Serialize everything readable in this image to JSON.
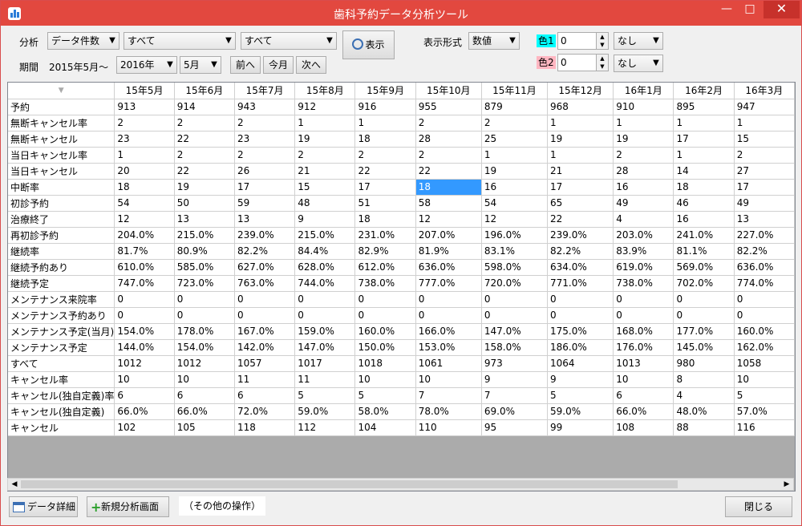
{
  "window": {
    "title": "歯科予約データ分析ツール"
  },
  "toolbar": {
    "analysis_label": "分析",
    "analysis_type": "データ件数",
    "filter1": "すべて",
    "filter2": "すべて",
    "show_button": "表示",
    "period_label": "期間",
    "period_start": "2015年5月～",
    "year": "2016年",
    "month": "5月",
    "prev_button": "前へ",
    "this_month_button": "今月",
    "next_button": "次へ",
    "display_format_label": "表示形式",
    "display_format": "数値",
    "color1_label": "色1",
    "color1_value": "0",
    "color1_option": "なし",
    "color2_label": "色2",
    "color2_value": "0",
    "color2_option": "なし",
    "color1_swatch": "#00ffff",
    "color2_swatch": "#ffb6c1"
  },
  "table": {
    "columns": [
      "15年5月",
      "15年6月",
      "15年7月",
      "15年8月",
      "15年9月",
      "15年10月",
      "15年11月",
      "15年12月",
      "16年1月",
      "16年2月",
      "16年3月"
    ],
    "rows": [
      {
        "label": "予約",
        "values": [
          "913",
          "914",
          "943",
          "912",
          "916",
          "955",
          "879",
          "968",
          "910",
          "895",
          "947"
        ]
      },
      {
        "label": "無断キャンセル率",
        "values": [
          "2",
          "2",
          "2",
          "1",
          "1",
          "2",
          "2",
          "1",
          "1",
          "1",
          "1"
        ]
      },
      {
        "label": "無断キャンセル",
        "values": [
          "23",
          "22",
          "23",
          "19",
          "18",
          "28",
          "25",
          "19",
          "19",
          "17",
          "15"
        ]
      },
      {
        "label": "当日キャンセル率",
        "values": [
          "1",
          "2",
          "2",
          "2",
          "2",
          "2",
          "1",
          "1",
          "2",
          "1",
          "2"
        ]
      },
      {
        "label": "当日キャンセル",
        "values": [
          "20",
          "22",
          "26",
          "21",
          "22",
          "22",
          "19",
          "21",
          "28",
          "14",
          "27"
        ]
      },
      {
        "label": "中断率",
        "values": [
          "18",
          "19",
          "17",
          "15",
          "17",
          "18",
          "16",
          "17",
          "16",
          "18",
          "17"
        ]
      },
      {
        "label": "初診予約",
        "values": [
          "54",
          "50",
          "59",
          "48",
          "51",
          "58",
          "54",
          "65",
          "49",
          "46",
          "49"
        ]
      },
      {
        "label": "治療終了",
        "values": [
          "12",
          "13",
          "13",
          "9",
          "18",
          "12",
          "12",
          "22",
          "4",
          "16",
          "13"
        ]
      },
      {
        "label": "再初診予約",
        "values": [
          "204.0%",
          "215.0%",
          "239.0%",
          "215.0%",
          "231.0%",
          "207.0%",
          "196.0%",
          "239.0%",
          "203.0%",
          "241.0%",
          "227.0%"
        ]
      },
      {
        "label": "継続率",
        "values": [
          "81.7%",
          "80.9%",
          "82.2%",
          "84.4%",
          "82.9%",
          "81.9%",
          "83.1%",
          "82.2%",
          "83.9%",
          "81.1%",
          "82.2%"
        ]
      },
      {
        "label": "継続予約あり",
        "values": [
          "610.0%",
          "585.0%",
          "627.0%",
          "628.0%",
          "612.0%",
          "636.0%",
          "598.0%",
          "634.0%",
          "619.0%",
          "569.0%",
          "636.0%"
        ]
      },
      {
        "label": "継続予定",
        "values": [
          "747.0%",
          "723.0%",
          "763.0%",
          "744.0%",
          "738.0%",
          "777.0%",
          "720.0%",
          "771.0%",
          "738.0%",
          "702.0%",
          "774.0%"
        ]
      },
      {
        "label": "メンテナンス来院率",
        "values": [
          "0",
          "0",
          "0",
          "0",
          "0",
          "0",
          "0",
          "0",
          "0",
          "0",
          "0"
        ]
      },
      {
        "label": "メンテナンス予約あり",
        "values": [
          "0",
          "0",
          "0",
          "0",
          "0",
          "0",
          "0",
          "0",
          "0",
          "0",
          "0"
        ]
      },
      {
        "label": "メンテナンス予定(当月)",
        "values": [
          "154.0%",
          "178.0%",
          "167.0%",
          "159.0%",
          "160.0%",
          "166.0%",
          "147.0%",
          "175.0%",
          "168.0%",
          "177.0%",
          "160.0%"
        ]
      },
      {
        "label": "メンテナンス予定",
        "values": [
          "144.0%",
          "154.0%",
          "142.0%",
          "147.0%",
          "150.0%",
          "153.0%",
          "158.0%",
          "186.0%",
          "176.0%",
          "145.0%",
          "162.0%"
        ]
      },
      {
        "label": "すべて",
        "values": [
          "1012",
          "1012",
          "1057",
          "1017",
          "1018",
          "1061",
          "973",
          "1064",
          "1013",
          "980",
          "1058"
        ]
      },
      {
        "label": "キャンセル率",
        "values": [
          "10",
          "10",
          "11",
          "11",
          "10",
          "10",
          "9",
          "9",
          "10",
          "8",
          "10"
        ]
      },
      {
        "label": "キャンセル(独自定義)率",
        "values": [
          "6",
          "6",
          "6",
          "5",
          "5",
          "7",
          "7",
          "5",
          "6",
          "4",
          "5"
        ]
      },
      {
        "label": "キャンセル(独自定義)",
        "values": [
          "66.0%",
          "66.0%",
          "72.0%",
          "59.0%",
          "58.0%",
          "78.0%",
          "69.0%",
          "59.0%",
          "66.0%",
          "48.0%",
          "57.0%"
        ]
      },
      {
        "label": "キャンセル",
        "values": [
          "102",
          "105",
          "118",
          "112",
          "104",
          "110",
          "95",
          "99",
          "108",
          "88",
          "116"
        ]
      }
    ],
    "selected": {
      "row": 5,
      "col": 5
    }
  },
  "footer": {
    "data_detail_button": "データ詳細",
    "new_analysis_button": "新規分析画面",
    "other_ops_label": "（その他の操作）",
    "close_button": "閉じる"
  },
  "icons": {
    "app": "bar-chart-icon",
    "search": "magnifier-icon",
    "table": "table-icon",
    "add": "plus-icon"
  }
}
